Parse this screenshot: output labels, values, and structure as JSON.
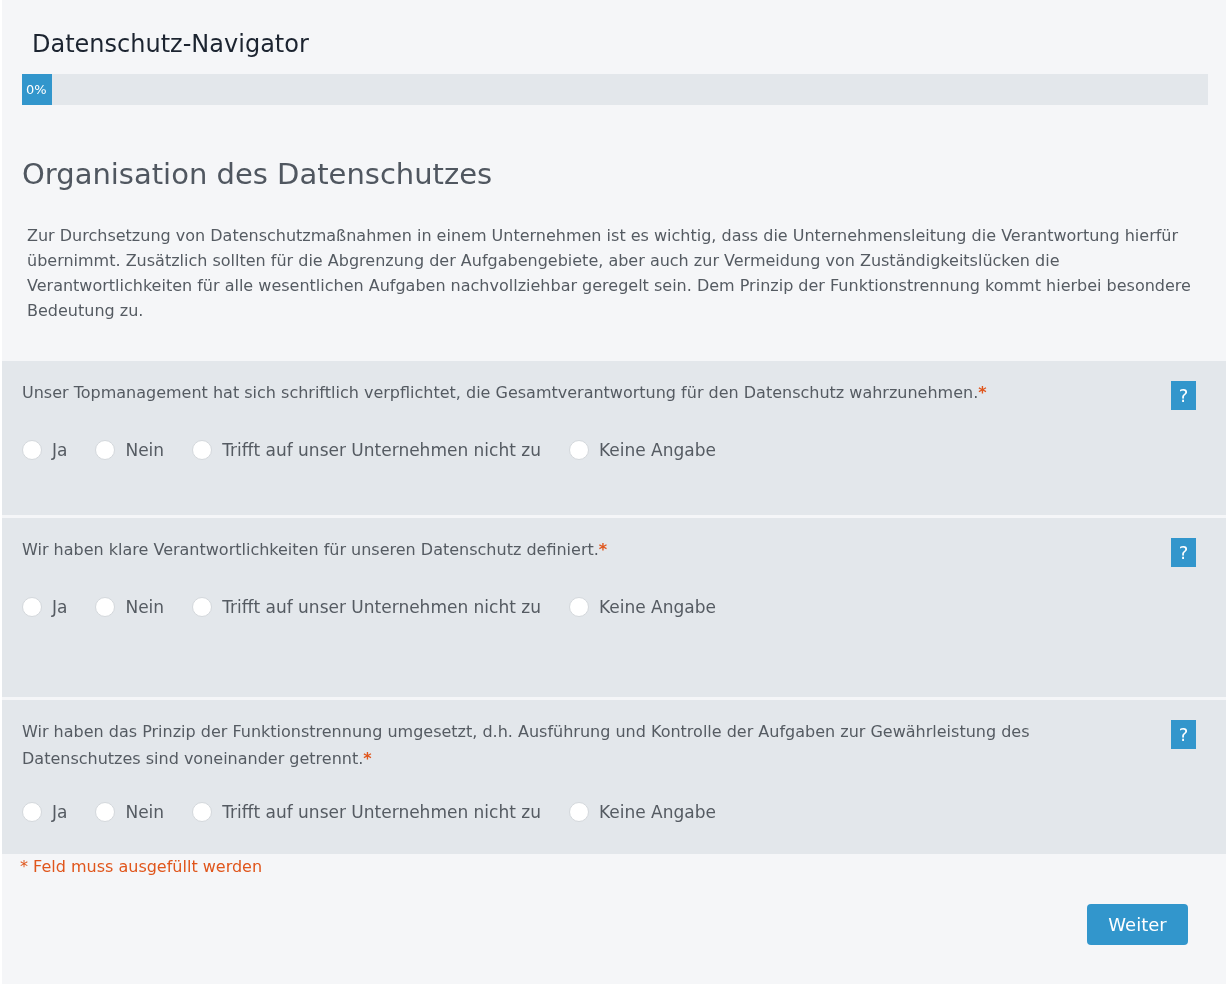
{
  "header": {
    "title": "Datenschutz-Navigator"
  },
  "progress": {
    "level": 0,
    "label": "0%"
  },
  "section": {
    "title": "Organisation des Datenschutzes",
    "intro": "Zur Durchsetzung von Datenschutzmaßnahmen in einem Unternehmen ist es wichtig, dass die Unternehmensleitung die Verantwortung hierfür übernimmt. Zusätzlich sollten für die Abgrenzung der Aufgabengebiete, aber auch zur Vermeidung von Zuständigkeitslücken die Verantwortlichkeiten für alle wesentlichen Aufgaben nachvollziehbar geregelt sein. Dem Prinzip der Funktionstrennung kommt hierbei besondere Bedeutung zu."
  },
  "questions": [
    {
      "text": "Unser Topmanagement hat sich schriftlich verpflichtet, die Gesamtverantwortung für den Datenschutz wahrzunehmen.",
      "required_mark": "*",
      "help": "?",
      "options": [
        {
          "label": "Ja",
          "selected": false
        },
        {
          "label": "Nein",
          "selected": false
        },
        {
          "label": "Trifft auf unser Unternehmen nicht zu",
          "selected": false
        },
        {
          "label": "Keine Angabe",
          "selected": false
        }
      ]
    },
    {
      "text": "Wir haben klare Verantwortlichkeiten für unseren Datenschutz definiert.",
      "required_mark": "*",
      "help": "?",
      "options": [
        {
          "label": "Ja",
          "selected": false
        },
        {
          "label": "Nein",
          "selected": false
        },
        {
          "label": "Trifft auf unser Unternehmen nicht zu",
          "selected": false
        },
        {
          "label": "Keine Angabe",
          "selected": false
        }
      ]
    },
    {
      "text": "Wir haben das Prinzip der Funktionstrennung umgesetzt, d.h. Ausführung und Kontrolle der Aufgaben zur Gewährleistung des Datenschutzes sind voneinander getrennt.",
      "required_mark": "*",
      "help": "?",
      "options": [
        {
          "label": "Ja",
          "selected": false
        },
        {
          "label": "Nein",
          "selected": false
        },
        {
          "label": "Trifft auf unser Unternehmen nicht zu",
          "selected": false
        },
        {
          "label": "Keine Angabe",
          "selected": false
        }
      ]
    }
  ],
  "required_note": "* Feld muss ausgefüllt werden",
  "next_button": "Weiter"
}
